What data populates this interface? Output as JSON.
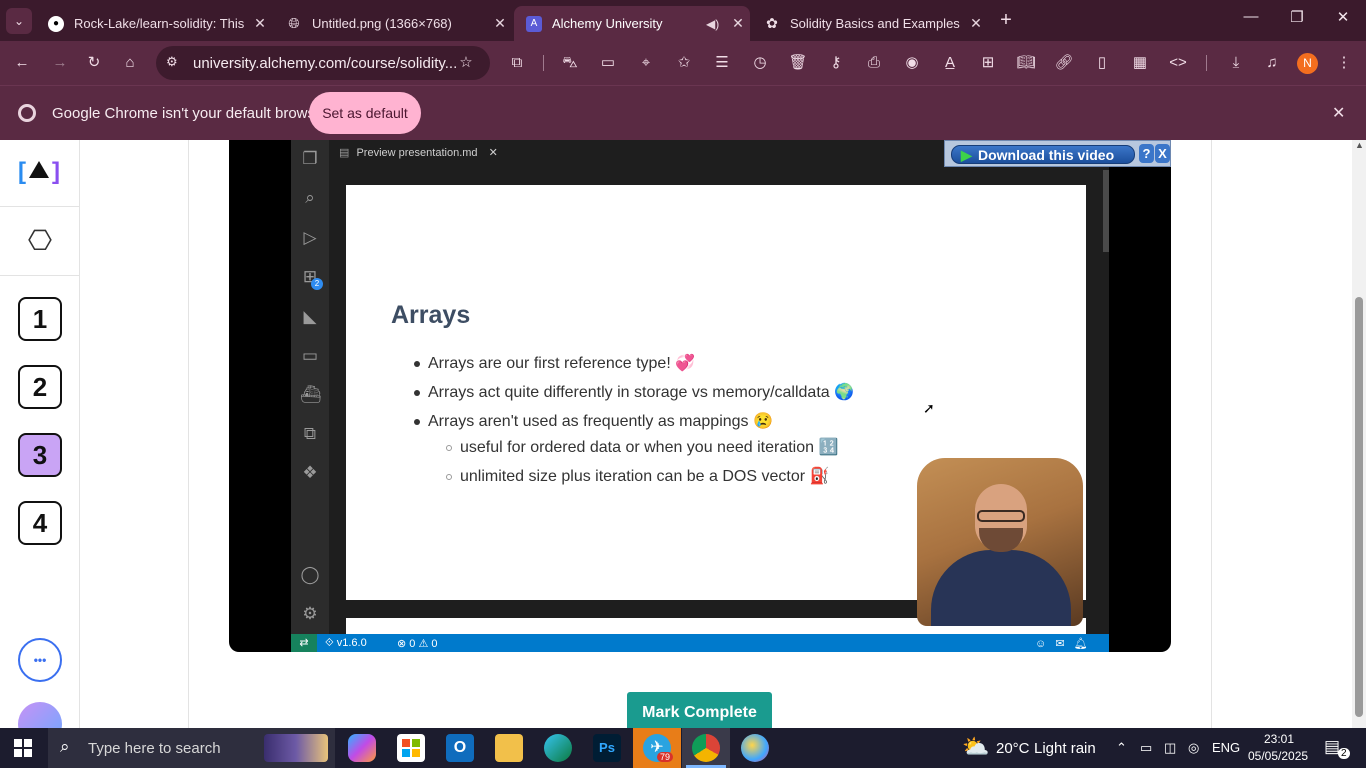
{
  "browser": {
    "tabs": [
      {
        "title": "Rock-Lake/learn-solidity: This is",
        "active": false
      },
      {
        "title": "Untitled.png (1366×768)",
        "active": false
      },
      {
        "title": "Alchemy University",
        "active": true
      },
      {
        "title": "Solidity Basics and Examples",
        "active": false
      }
    ],
    "url": "university.alchemy.com/course/solidity...",
    "profile_initial": "N",
    "infobar_text": "Google Chrome isn't your default browser",
    "infobar_button": "Set as default"
  },
  "sidebar": {
    "steps": [
      "1",
      "2",
      "3",
      "4"
    ],
    "current_step": "3",
    "more_label": "•••"
  },
  "video": {
    "editor_tab": "Preview presentation.md",
    "slide_title": "Arrays",
    "bullets": [
      "Arrays are our first reference type! 💞",
      "Arrays act quite differently in storage vs memory/calldata 🌍",
      "Arrays aren't used as frequently as mappings 😢"
    ],
    "sub_bullets": [
      "useful for ordered data or when you need iteration 🔢",
      "unlimited size plus iteration can be a DOS vector ⛽"
    ],
    "status_version": "v1.6.0",
    "status_errors": "0",
    "status_warnings": "0",
    "activity_badge": "2",
    "download_label": "Download this video",
    "help_label": "?",
    "close_label": "X"
  },
  "main": {
    "mark_complete": "Mark Complete"
  },
  "taskbar": {
    "search_placeholder": "Type here to search",
    "weather_temp": "20°C",
    "weather_desc": "Light rain",
    "language": "ENG",
    "time": "23:01",
    "date": "05/05/2025",
    "notification_count": "2",
    "telegram_badge": "79"
  },
  "colors": {
    "chrome_dark": "#3b1a2c",
    "chrome_toolbar": "#5a2a43",
    "set_default_bg": "#ffb3d1",
    "current_step_bg": "#c9a4f5",
    "mark_complete_bg": "#1a9b8f",
    "vscode_status": "#007acc"
  }
}
